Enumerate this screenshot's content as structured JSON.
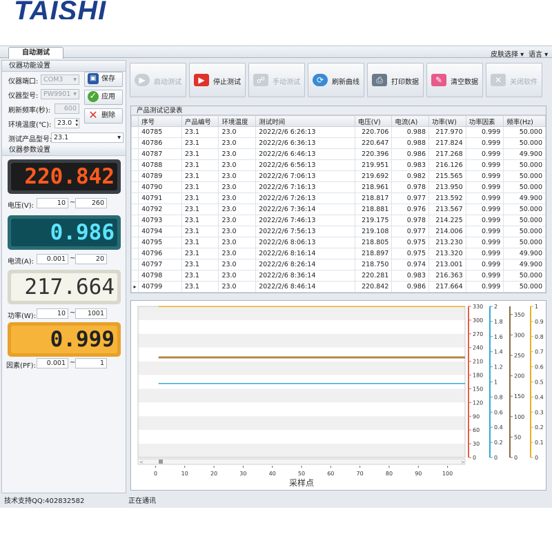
{
  "logo": {
    "text": "TAISHI"
  },
  "tabs": [
    {
      "label": "自动测试"
    }
  ],
  "topmenu": {
    "skin": "皮肤选择 ▾",
    "lang": "语言 ▾"
  },
  "device_settings": {
    "title": "仪器功能设置",
    "port_label": "仪器端口:",
    "port_value": "COM3",
    "model_label": "仪器型号:",
    "model_value": "PW9901",
    "refresh_label": "刷新频率(秒):",
    "refresh_value": "600",
    "temp_label": "环境温度(℃):",
    "temp_value": "23.0",
    "product_label": "测试产品型号:",
    "product_value": "23.1",
    "save_label": "保存",
    "apply_label": "应用",
    "delete_label": "删除"
  },
  "param_settings": {
    "title": "仪器参数设置",
    "voltage": {
      "display": "220.842",
      "label": "电压(V):",
      "min": "10",
      "max": "260"
    },
    "current": {
      "display": "0.986",
      "label": "电流(A):",
      "min": "0.001",
      "max": "20"
    },
    "power": {
      "display": "217.664",
      "label": "功率(W):",
      "min": "10",
      "max": "1001"
    },
    "pf": {
      "display": "0.999",
      "label": "因素(PF):",
      "min": "0.001",
      "max": "1"
    },
    "tilde": "~"
  },
  "toolbar": {
    "start": "启动测试",
    "stop": "停止测试",
    "manual": "手动测试",
    "refresh": "刷新曲线",
    "print": "打印数据",
    "clear": "清空数据",
    "close": "关闭软件"
  },
  "table": {
    "caption": "产品测试记录表",
    "columns": [
      "序号",
      "产品编号",
      "环境温度",
      "测试时间",
      "电压(V)",
      "电流(A)",
      "功率(W)",
      "功率因素",
      "频率(Hz)"
    ],
    "rows": [
      [
        "40785",
        "23.1",
        "23.0",
        "2022/2/6 6:26:13",
        "220.706",
        "0.988",
        "217.970",
        "0.999",
        "50.000"
      ],
      [
        "40786",
        "23.1",
        "23.0",
        "2022/2/6 6:36:13",
        "220.647",
        "0.988",
        "217.824",
        "0.999",
        "50.000"
      ],
      [
        "40787",
        "23.1",
        "23.0",
        "2022/2/6 6:46:13",
        "220.396",
        "0.986",
        "217.268",
        "0.999",
        "49.900"
      ],
      [
        "40788",
        "23.1",
        "23.0",
        "2022/2/6 6:56:13",
        "219.951",
        "0.983",
        "216.126",
        "0.999",
        "50.000"
      ],
      [
        "40789",
        "23.1",
        "23.0",
        "2022/2/6 7:06:13",
        "219.692",
        "0.982",
        "215.565",
        "0.999",
        "50.000"
      ],
      [
        "40790",
        "23.1",
        "23.0",
        "2022/2/6 7:16:13",
        "218.961",
        "0.978",
        "213.950",
        "0.999",
        "50.000"
      ],
      [
        "40791",
        "23.1",
        "23.0",
        "2022/2/6 7:26:13",
        "218.817",
        "0.977",
        "213.592",
        "0.999",
        "49.900"
      ],
      [
        "40792",
        "23.1",
        "23.0",
        "2022/2/6 7:36:14",
        "218.881",
        "0.976",
        "213.567",
        "0.999",
        "50.000"
      ],
      [
        "40793",
        "23.1",
        "23.0",
        "2022/2/6 7:46:13",
        "219.175",
        "0.978",
        "214.225",
        "0.999",
        "50.000"
      ],
      [
        "40794",
        "23.1",
        "23.0",
        "2022/2/6 7:56:13",
        "219.108",
        "0.977",
        "214.006",
        "0.999",
        "50.000"
      ],
      [
        "40795",
        "23.1",
        "23.0",
        "2022/2/6 8:06:13",
        "218.805",
        "0.975",
        "213.230",
        "0.999",
        "50.000"
      ],
      [
        "40796",
        "23.1",
        "23.0",
        "2022/2/6 8:16:14",
        "218.897",
        "0.975",
        "213.320",
        "0.999",
        "49.900"
      ],
      [
        "40797",
        "23.1",
        "23.0",
        "2022/2/6 8:26:14",
        "218.750",
        "0.974",
        "213.001",
        "0.999",
        "49.900"
      ],
      [
        "40798",
        "23.1",
        "23.0",
        "2022/2/6 8:36:14",
        "220.281",
        "0.983",
        "216.363",
        "0.999",
        "50.000"
      ],
      [
        "40799",
        "23.1",
        "23.0",
        "2022/2/6 8:46:14",
        "220.842",
        "0.986",
        "217.664",
        "0.999",
        "50.000"
      ]
    ],
    "current_row_marker": "▸"
  },
  "chart_data": {
    "type": "line",
    "xlabel": "采样点",
    "xlim": [
      -6,
      106
    ],
    "xticks": [
      0,
      10,
      20,
      30,
      40,
      50,
      60,
      70,
      80,
      90,
      100
    ],
    "axes": [
      {
        "range": [
          0,
          330
        ],
        "ticks": [
          "0",
          "30",
          "60",
          "90",
          "120",
          "150",
          "180",
          "210",
          "240",
          "270",
          "300",
          "330"
        ],
        "color": "#e0604a"
      },
      {
        "range": [
          0,
          2
        ],
        "ticks": [
          "0",
          "0.2",
          "0.4",
          "0.6",
          "0.8",
          "1",
          "1.2",
          "1.4",
          "1.6",
          "1.8",
          "2"
        ],
        "color": "#3aa6d6"
      },
      {
        "range": [
          0,
          370
        ],
        "ticks": [
          "0",
          "50",
          "100",
          "150",
          "200",
          "250",
          "300",
          "350"
        ],
        "color": "#8a6a40"
      },
      {
        "range": [
          0,
          1
        ],
        "ticks": [
          "0",
          "0.1",
          "0.2",
          "0.3",
          "0.4",
          "0.5",
          "0.6",
          "0.7",
          "0.8",
          "0.9",
          "1"
        ],
        "color": "#e8b020"
      }
    ],
    "series": [
      {
        "axis": 3,
        "color": "#e8b020",
        "x": [
          1,
          106
        ],
        "values": [
          0.999,
          0.999
        ]
      },
      {
        "axis": 0,
        "color": "#b8844a",
        "x": [
          1,
          106
        ],
        "values": [
          218.5,
          218.5
        ]
      },
      {
        "axis": 1,
        "color": "#3aa6d6",
        "x": [
          1,
          106
        ],
        "values": [
          0.98,
          0.98
        ]
      }
    ]
  },
  "status": {
    "support": "技术支持QQ:402832582",
    "state": "正在通讯"
  },
  "colors": {
    "lcd_red": "#ff5a1e",
    "lcd_cyan": "#1ec8e8",
    "lcd_power_bg": "#f4f4ea",
    "lcd_pf_bg": "#f6b53a"
  }
}
